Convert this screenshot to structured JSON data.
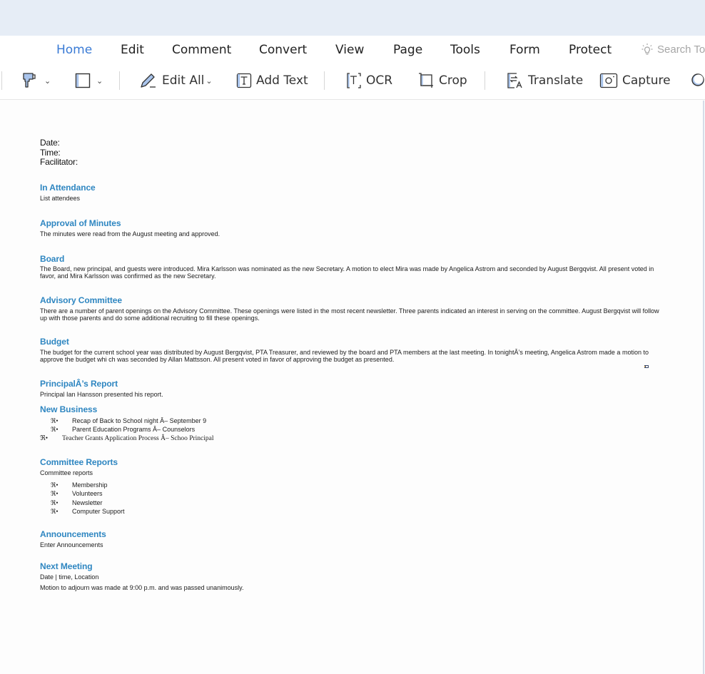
{
  "menu": {
    "tabs": [
      {
        "label": "Home",
        "active": true
      },
      {
        "label": "Edit"
      },
      {
        "label": "Comment"
      },
      {
        "label": "Convert"
      },
      {
        "label": "View"
      },
      {
        "label": "Page"
      },
      {
        "label": "Tools"
      },
      {
        "label": "Form"
      },
      {
        "label": "Protect"
      }
    ],
    "search_label": "Search To",
    "search_icon": "lightbulb-icon",
    "accent_color": "#3a7bd5"
  },
  "toolbar": {
    "format_painter_icon": "format-painter-icon",
    "shape_icon": "rectangle-icon",
    "edit_all_label": "Edit All",
    "add_text_label": "Add Text",
    "ocr_label": "OCR",
    "crop_label": "Crop",
    "translate_label": "Translate",
    "capture_label": "Capture",
    "search_icon": "search-icon"
  },
  "document": {
    "heading_color": "#2e86c1",
    "meta": [
      "Date:",
      "Time:",
      "Facilitator:"
    ],
    "sections": {
      "attendance": {
        "heading": "In Attendance",
        "body": "List attendees"
      },
      "minutes": {
        "heading": "Approval of Minutes",
        "body": "The minutes were read from the August meeting and approved."
      },
      "board": {
        "heading": "Board",
        "body": "The Board, new principal, and guests were introduced. Mira Karlsson was nominated as the new Secretary. A motion to elect Mira was made by Angelica Astrom and seconded by August Bergqvist. All present voted in favor, and Mira Karlsson was confirmed as the new Secretary."
      },
      "advisory": {
        "heading": "Advisory Committee",
        "body": "There are a number of parent openings on the Advisory Committee. These openings were listed in the most recent newsletter. Three parents indicated an interest in serving on the committee. August Bergqvist will follow up with those parents and do some additional recruiting to fill these openings."
      },
      "budget": {
        "heading": "Budget",
        "body": "The budget for the current school year was distributed by August Bergqvist, PTA Treasurer, and reviewed by the board and PTA members at the last meeting. In tonightÂ’s meeting, Angelica Astrom made a motion to approve the budget whi ch was seconded by Allan Mattsson. All present voted in favor of approving the budget as presented."
      },
      "principal": {
        "heading": "PrincipalÂ’s Report",
        "body": "Principal Ian Hansson presented his report."
      },
      "new_business": {
        "heading": "New Business",
        "bullet_mark": "ℜ•",
        "items": [
          "Recap of Back to School night Â– September 9",
          "Parent Education Programs Â– Counselors",
          "Teacher Grants Application Process Â– Schoo Principal"
        ]
      },
      "committee": {
        "heading": "Committee Reports",
        "body": "Committee reports",
        "bullet_mark": "ℜ•",
        "items": [
          "Membership",
          "Volunteers",
          "Newsletter",
          "Computer Support"
        ]
      },
      "announcements": {
        "heading": "Announcements",
        "body": "Enter Announcements"
      },
      "next_meeting": {
        "heading": "Next Meeting",
        "body": "Date | time, Location",
        "footer": "Motion to adjourn was made at 9:00 p.m. and was passed unanimously."
      }
    }
  }
}
